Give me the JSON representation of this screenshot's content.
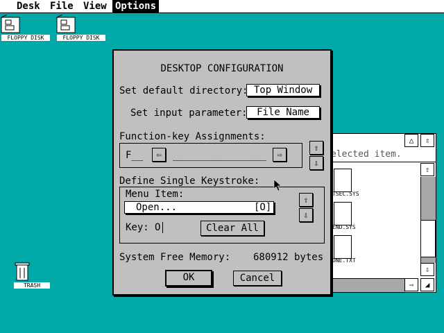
{
  "menubar": {
    "items": [
      "Desk",
      "File",
      "View",
      "Options"
    ]
  },
  "desktop": {
    "drives": [
      {
        "label": "FLOPPY DISK",
        "icon": "floppy-drive-icon"
      },
      {
        "label": "FLOPPY DISK",
        "icon": "floppy-drive-icon"
      }
    ],
    "trash": {
      "label": "TRASH",
      "icon": "trash-can-icon"
    }
  },
  "background_window": {
    "info_text": "elected item.",
    "files": [
      "TSEC.SYS",
      "END.SYS",
      "ONE.TXT"
    ],
    "arrow_up": "⇧",
    "arrow_down": "⇩",
    "arrow_right": "⇨",
    "resize": "◢",
    "full": "⇳",
    "fuller": "△"
  },
  "dialog": {
    "title": "DESKTOP CONFIGURATION",
    "default_dir_label": "Set default directory:",
    "default_dir_value": "Top Window",
    "input_param_label": "Set input parameter:",
    "input_param_value": "File Name",
    "fkey_label": "Function-key Assignments:",
    "fkey_name": "F__",
    "fkey_value": "________________",
    "keystroke_label": "Define Single Keystroke:",
    "menu_item_label": "Menu Item:",
    "menu_item_name": "Open...",
    "menu_item_key": "[O]",
    "key_label": "Key:",
    "key_value": "O",
    "clear_all": "Clear All",
    "memory_label": "System Free Memory:",
    "memory_value": "680912 bytes",
    "ok": "OK",
    "cancel": "Cancel",
    "arrow_left": "⇦",
    "arrow_right": "⇨",
    "arrow_up": "⇧",
    "arrow_down": "⇩"
  }
}
